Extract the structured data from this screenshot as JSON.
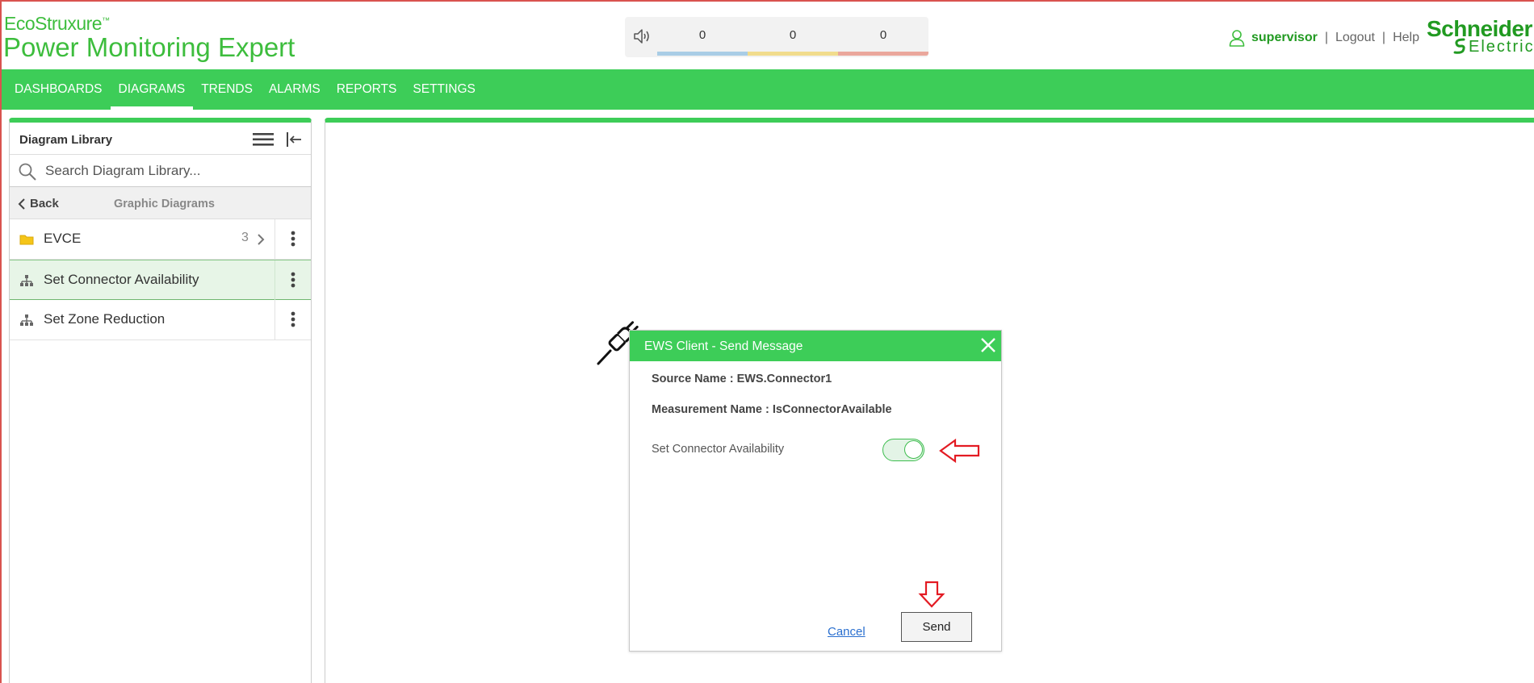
{
  "brand": {
    "top": "EcoStruxure",
    "tm": "™",
    "main": "Power Monitoring Expert"
  },
  "alarms": {
    "low": "0",
    "medium": "0",
    "high": "0",
    "colors": {
      "low": "#a9cde6",
      "medium": "#f1dc8d",
      "high": "#eaa79c"
    },
    "icon": "speaker-icon"
  },
  "user": {
    "name": "supervisor",
    "sep": "|",
    "logout": "Logout",
    "help": "Help"
  },
  "vendor": {
    "line1": "Schneider",
    "line2": "Electric"
  },
  "nav": {
    "items": [
      "DASHBOARDS",
      "DIAGRAMS",
      "TRENDS",
      "ALARMS",
      "REPORTS",
      "SETTINGS"
    ],
    "active": "DIAGRAMS"
  },
  "library": {
    "title": "Diagram Library",
    "search_placeholder": "Search Diagram Library...",
    "back_label": "Back",
    "breadcrumb": "Graphic Diagrams",
    "items": [
      {
        "label": "EVCE",
        "count": "3",
        "icon": "folder-icon"
      },
      {
        "label": "Set Connector Availability",
        "icon": "diagram-icon"
      },
      {
        "label": "Set Zone Reduction",
        "icon": "diagram-icon"
      }
    ]
  },
  "dialog": {
    "title": "EWS Client - Send Message",
    "source": "Source Name : EWS.Connector1",
    "measurement": "Measurement Name : IsConnectorAvailable",
    "toggle_label": "Set Connector Availability",
    "toggle_on": true,
    "cancel": "Cancel",
    "send": "Send"
  },
  "colors": {
    "accent": "#3dcd58",
    "brand_green": "#219a21",
    "annotation_red": "#e31b23"
  }
}
